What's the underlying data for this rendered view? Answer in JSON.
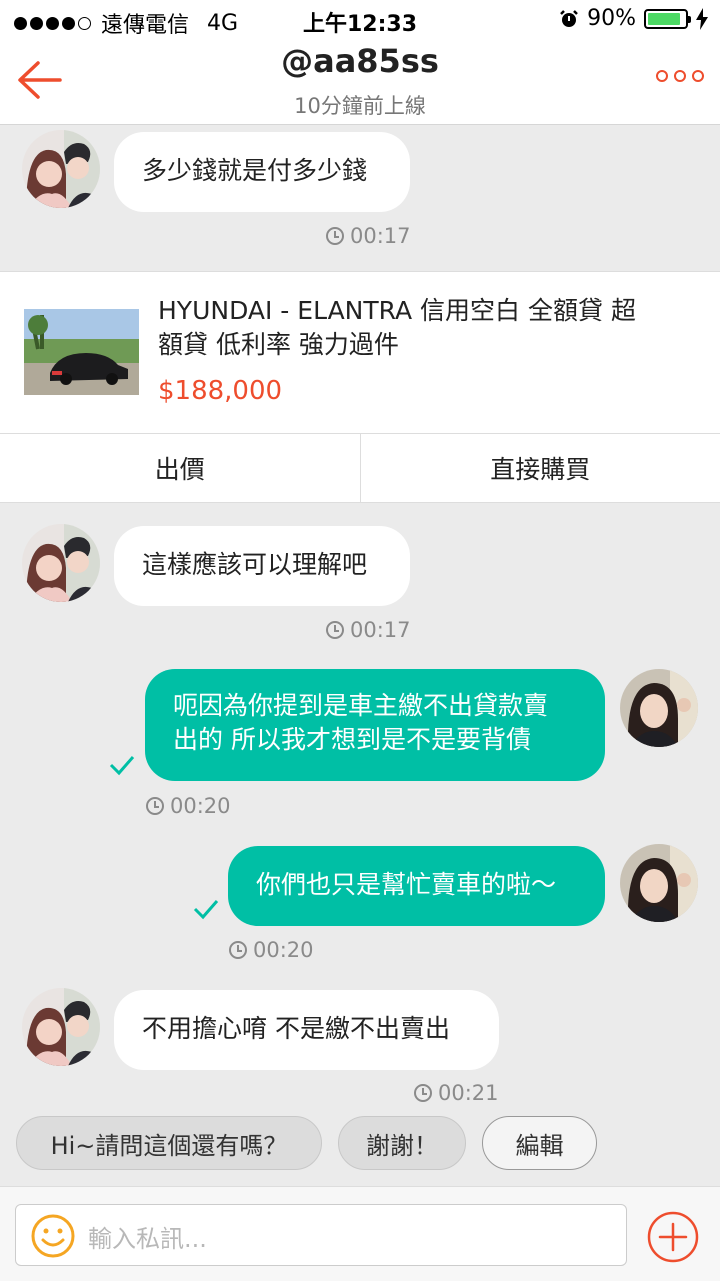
{
  "status_bar": {
    "carrier": "遠傳電信",
    "network": "4G",
    "time": "上午12:33",
    "battery": "90%",
    "battery_level": 0.9
  },
  "header": {
    "title": "@aa85ss",
    "subtitle": "10分鐘前上線",
    "icons": [
      "back-arrow-icon",
      "more-options-icon"
    ]
  },
  "messages": [
    {
      "text": "多少錢就是付多少錢",
      "time": "00:17"
    },
    {
      "text": "這樣應該可以理解吧",
      "time": "00:17"
    },
    {
      "lines": [
        "呃因為你提到是車主繳不出貸款賣",
        "出的 所以我才想到是不是要背債"
      ],
      "time": "00:20"
    },
    {
      "text": "你們也只是幫忙賣車的啦～",
      "time": "00:20"
    },
    {
      "text": "不用擔心唷 不是繳不出賣出",
      "time": "00:21"
    }
  ],
  "product": {
    "title_lines": [
      "HYUNDAI - ELANTRA  信用空白 全額貸 超",
      "額貸  低利率 強力過件"
    ],
    "price": "$188,000",
    "offer_label": "出價",
    "buy_label": "直接購買"
  },
  "quick_replies": [
    "Hi~請問這個還有嗎？",
    "謝謝！",
    "編輯"
  ],
  "input": {
    "placeholder": "輸入私訊..."
  },
  "colors": {
    "accent": "#ee4d2d",
    "outgoing_bubble": "#00bfa5",
    "background": "#ebebeb"
  }
}
